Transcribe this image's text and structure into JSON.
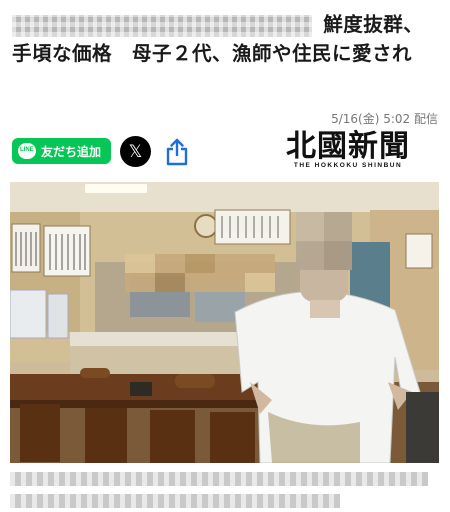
{
  "article": {
    "headline_text": "鮮度抜群、手頃な価格　母子２代、漁師や住民に愛され",
    "dateline": "5/16(金) 5:02 配信"
  },
  "actions": {
    "line_label": "友だち追加",
    "x_label": "𝕏",
    "line_icon_text": "LINE"
  },
  "publisher": {
    "name": "北國新聞",
    "name_en": "THE HOKKOKU SHINBUN"
  },
  "icons": {
    "line": "line-logo-icon",
    "x": "x-logo-icon",
    "share": "share-icon"
  },
  "colors": {
    "line_green": "#06c755",
    "share_blue": "#1e6fd9"
  }
}
